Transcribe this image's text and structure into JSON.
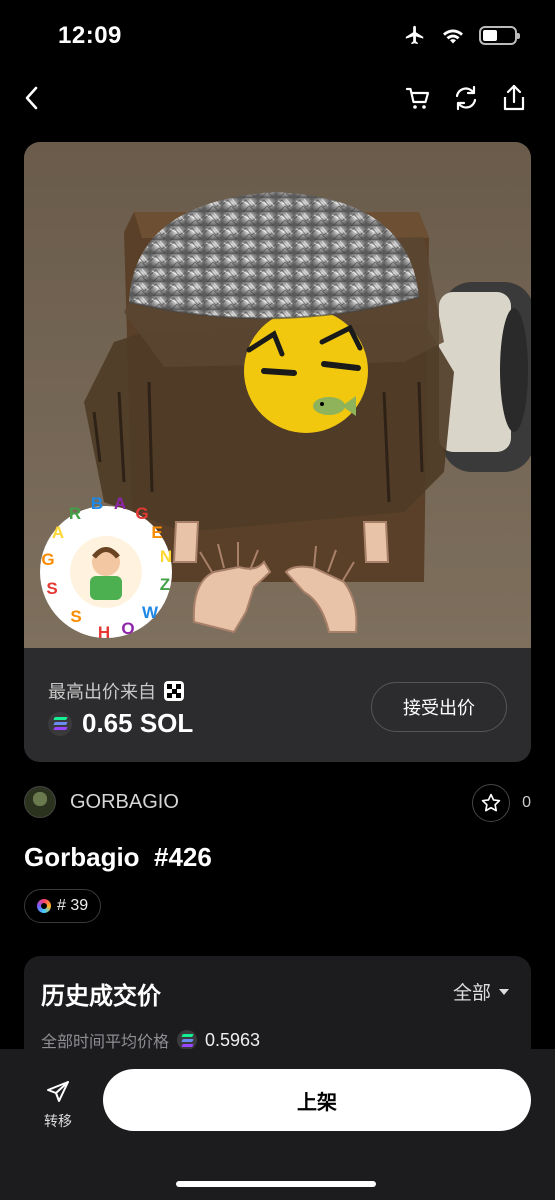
{
  "status_bar": {
    "time": "12:09",
    "battery_level": 0.45
  },
  "nav": {
    "back_icon": "chevron-left-icon",
    "cart_icon": "cart-icon",
    "refresh_icon": "refresh-icon",
    "share_icon": "share-icon"
  },
  "nft_image": {
    "sticker_text_top": "GARBAGE",
    "sticker_text_bottom": "SHOWZ",
    "sticker_letters": [
      "S",
      "G",
      "A",
      "R",
      "B",
      "A",
      "G",
      "E",
      "N",
      "Z",
      "W",
      "O",
      "H",
      "S"
    ]
  },
  "offer": {
    "label": "最高出价来自",
    "value": "0.65 SOL",
    "accept_label": "接受出价"
  },
  "collection": {
    "name": "GORBAGIO",
    "favorites": "0"
  },
  "nft": {
    "title": "Gorbagio  #426",
    "rank": "# 39"
  },
  "history": {
    "title": "历史成交价",
    "filter": "全部",
    "avg_label": "全部时间平均价格",
    "avg_value": "0.5963"
  },
  "bottom": {
    "transfer_label": "转移",
    "list_label": "上架"
  },
  "colors": {
    "sol_teal": "#14f195",
    "sol_purple": "#9945ff",
    "card_bg": "#2c2c2e"
  }
}
